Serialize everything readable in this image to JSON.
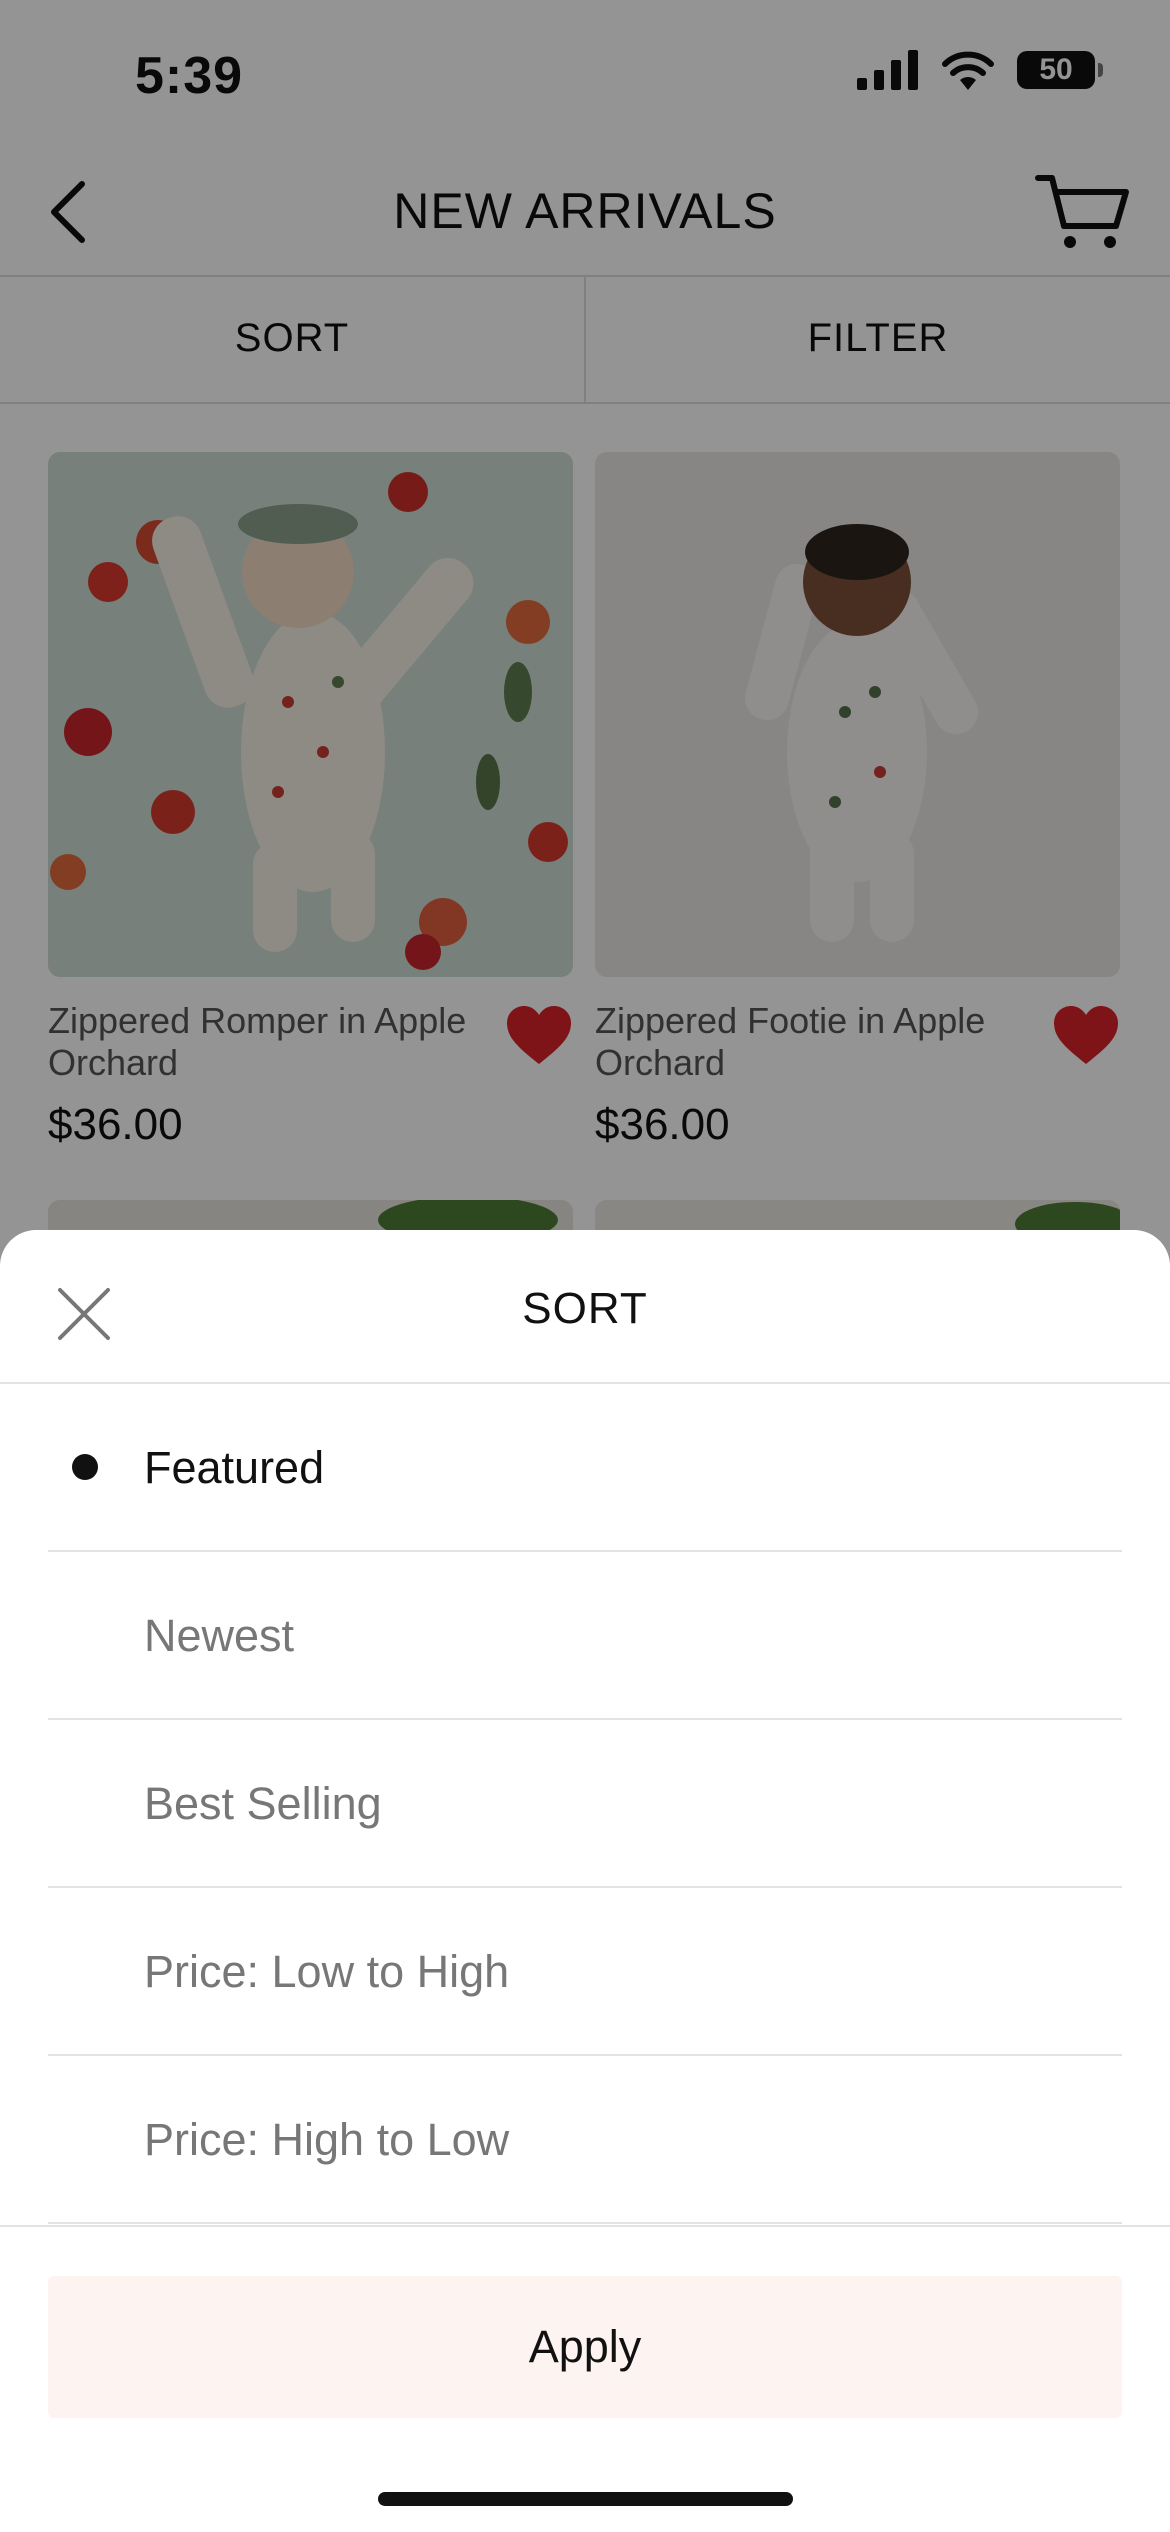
{
  "status_bar": {
    "time": "5:39",
    "battery": "50"
  },
  "header": {
    "title": "NEW ARRIVALS"
  },
  "toolbar": {
    "sort_label": "SORT",
    "filter_label": "FILTER"
  },
  "products": [
    {
      "name": "Zippered Romper in Apple Orchard",
      "price": "$36.00",
      "favorited": true
    },
    {
      "name": "Zippered Footie in Apple Orchard",
      "price": "$36.00",
      "favorited": true
    }
  ],
  "sort_sheet": {
    "title": "SORT",
    "options": [
      {
        "label": "Featured",
        "selected": true
      },
      {
        "label": "Newest",
        "selected": false
      },
      {
        "label": "Best Selling",
        "selected": false
      },
      {
        "label": "Price: Low to High",
        "selected": false
      },
      {
        "label": "Price: High to Low",
        "selected": false
      }
    ],
    "apply_label": "Apply"
  },
  "colors": {
    "heart": "#d9232a",
    "apply_bg": "#fdf3f1",
    "overlay": "rgba(0,0,0,0.42)"
  }
}
